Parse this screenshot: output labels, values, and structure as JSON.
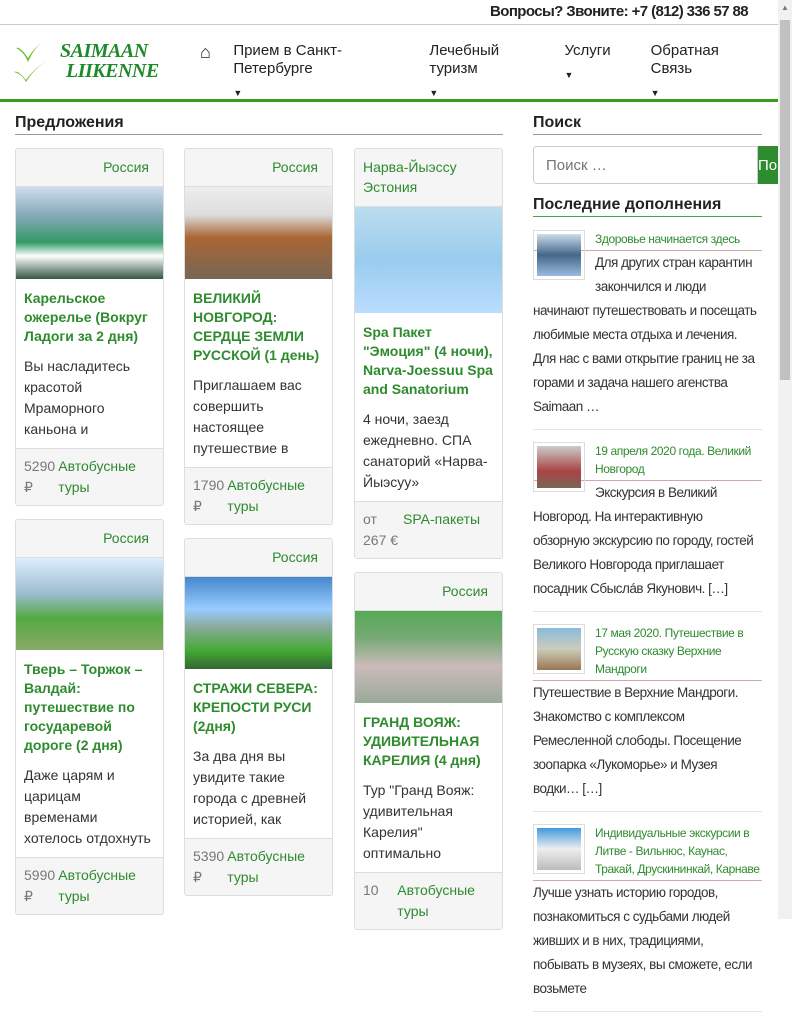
{
  "topbar": {
    "contact": "Вопросы? Звоните: +7 (812) 336 57 88"
  },
  "logo": {
    "line1": "SAIMAAN",
    "line2": "LIIKENNE"
  },
  "nav": [
    "Прием в Санкт-Петербурге",
    "Лечебный туризм",
    "Услуги",
    "Обратная Связь"
  ],
  "main": {
    "title": "Предложения"
  },
  "columns": [
    [
      {
        "country": "Россия",
        "title": "Карельское ожерелье (Вокруг Ладоги за 2 дня)",
        "excerpt": "Вы насладитесь красотой Мраморного каньона и",
        "price": "5290 ₽",
        "category": "Автобусные туры"
      },
      {
        "country": "Россия",
        "title": "Тверь – Торжок – Валдай: путешествие по государевой дороге (2 дня)",
        "excerpt": "Даже царям и царицам временами хотелось отдохнуть",
        "price": "5990 ₽",
        "category": "Автобусные туры"
      }
    ],
    [
      {
        "country": "Россия",
        "title": "ВЕЛИКИЙ НОВГОРОД: СЕРДЦЕ ЗЕМЛИ РУССКОЙ (1 день)",
        "excerpt": "Приглашаем вас совершить настоящее путешествие в",
        "price": "1790 ₽",
        "category": "Автобусные туры"
      },
      {
        "country": "Россия",
        "title": "СТРАЖИ СЕВЕРА: КРЕПОСТИ РУСИ (2дня)",
        "excerpt": "За два дня вы увидите такие города с древней историей, как",
        "price": "5390 ₽",
        "category": "Автобусные туры"
      }
    ],
    [
      {
        "country": "Нарва-Йыэссу Эстония",
        "title": "Spa Пакет \"Эмоция\" (4 ночи), Narva-Joessuu Spa and Sanatorium",
        "excerpt": "4 ночи, заезд ежедневно. СПА санаторий «Нарва-Йыэсуу»",
        "price": "от 267 €",
        "category": "SPA-пакеты"
      },
      {
        "country": "Россия",
        "title": "ГРАНД ВОЯЖ: УДИВИТЕЛЬНАЯ КАРЕЛИЯ  (4 дня)",
        "excerpt": "Тур \"Гранд Вояж: удивительная Карелия\" оптимально",
        "price": "10",
        "category": "Автобусные туры"
      }
    ]
  ],
  "sidebar": {
    "search_title": "Поиск",
    "search_placeholder": "Поиск …",
    "search_button": "Поиск",
    "recent_title": "Последние дополнения",
    "recent": [
      {
        "title": "Здоровье начинается здесь",
        "text": "Для других стран карантин закончился и люди начинают путешествовать и посещать любимые места отдыха и лечения. Для нас с вами открытие границ не за горами и задача нашего агенства Saimaan …"
      },
      {
        "title": "19 апреля 2020 года. Великий Новгород",
        "text": "Экскурсия в Великий Новгород. На интерактивную обзорную экскурсию по городу, гостей Великого Новгорода приглашает посадник Сбыслáв Якунович. […]"
      },
      {
        "title": "17 мая 2020. Путешествие в Русскую сказку Верхние Мандроги",
        "text": "Путешествие в Верхние Мандроги. Знакомство с комплексом Ремесленной слободы. Посещение зоопарка «Лукоморье» и Музея водки… […]"
      },
      {
        "title": "Индивидуальные экскурсии в Литве - Вильнюс, Каунас, Тракай, Друскининкай, Карнаве",
        "text": "Лучше узнать историю городов, познакомиться с судьбами людей живших и в них, традициями, побывать в музеях, вы сможете, если возьмете"
      }
    ]
  }
}
